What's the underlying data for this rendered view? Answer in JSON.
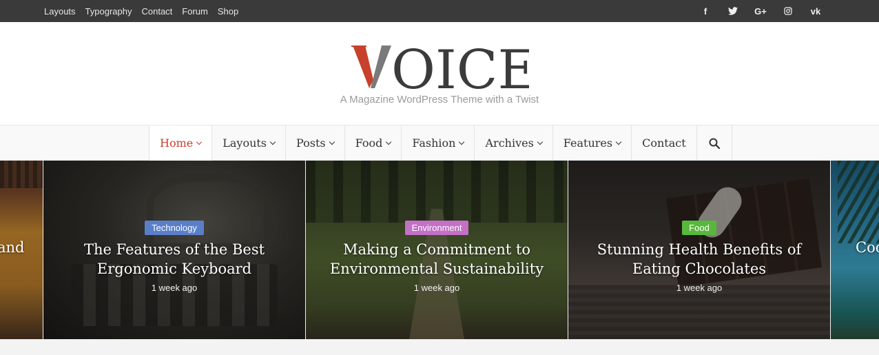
{
  "top_menu": [
    "Layouts",
    "Typography",
    "Contact",
    "Forum",
    "Shop"
  ],
  "social": [
    {
      "icon": "facebook-icon",
      "glyph": "f"
    },
    {
      "icon": "twitter-icon",
      "glyph": "❦"
    },
    {
      "icon": "google-plus-icon",
      "glyph": "G+"
    },
    {
      "icon": "instagram-icon",
      "glyph": "▣"
    },
    {
      "icon": "vk-icon",
      "glyph": "vk"
    }
  ],
  "logo": {
    "text": "VOICE",
    "accent_color": "#c8412c"
  },
  "tagline": "A Magazine WordPress Theme with a Twist",
  "nav": [
    {
      "label": "Home",
      "dropdown": true,
      "active": true
    },
    {
      "label": "Layouts",
      "dropdown": true
    },
    {
      "label": "Posts",
      "dropdown": true
    },
    {
      "label": "Food",
      "dropdown": true
    },
    {
      "label": "Fashion",
      "dropdown": true
    },
    {
      "label": "Archives",
      "dropdown": true
    },
    {
      "label": "Features",
      "dropdown": true
    },
    {
      "label": "Contact",
      "dropdown": false
    }
  ],
  "search_icon": "search-icon",
  "slider": {
    "left_partial_title": "and",
    "right_partial_title": "Coc",
    "slides": [
      {
        "category": "Technology",
        "category_color": "#5a7fc9",
        "title_line1": "The Features of the Best",
        "title_line2": "Ergonomic Keyboard",
        "date": "1 week ago"
      },
      {
        "category": "Environment",
        "category_color": "#c370c6",
        "title_line1": "Making a Commitment to",
        "title_line2": "Environmental Sustainability",
        "date": "1 week ago"
      },
      {
        "category": "Food",
        "category_color": "#58b83c",
        "title_line1": "Stunning Health Benefits of",
        "title_line2": "Eating Chocolates",
        "date": "1 week ago"
      }
    ]
  }
}
